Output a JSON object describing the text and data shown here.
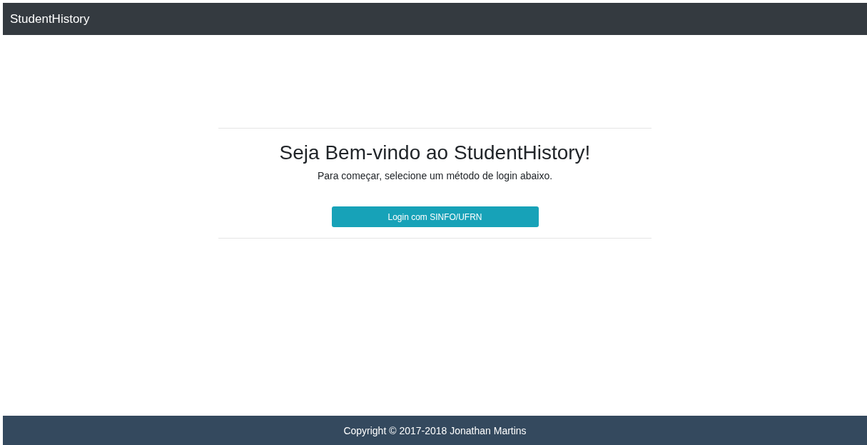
{
  "navbar": {
    "brand": "StudentHistory"
  },
  "welcome": {
    "title": "Seja Bem-vindo ao StudentHistory!",
    "subtitle": "Para começar, selecione um método de login abaixo.",
    "button": "Login com SINFO/UFRN"
  },
  "footer": {
    "text": "Copyright © 2017-2018 Jonathan Martins"
  }
}
